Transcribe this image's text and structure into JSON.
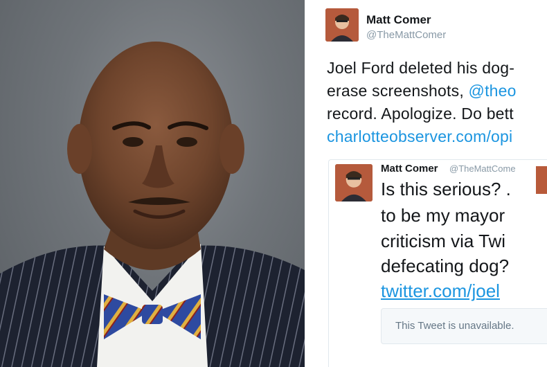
{
  "tweet": {
    "author_name": "Matt Comer",
    "author_handle": "@TheMattComer",
    "text_lines": [
      "Joel Ford deleted his dog-",
      "erase screenshots, ",
      "record. Apologize. Do bett",
      "charlotteobserver.com/opi"
    ],
    "mention_fragment": "@theo",
    "link_text": "charlotteobserver.com/opi"
  },
  "quoted": {
    "author_name": "Matt Comer",
    "author_handle": "@TheMattCome",
    "lines": [
      "Is this serious? .",
      "to be my mayor",
      "criticism via Twi",
      "defecating dog?",
      "twitter.com/joel"
    ],
    "unavailable_text": "This Tweet is unavailable."
  },
  "colors": {
    "link": "#1b95e0",
    "text": "#14171a",
    "muted": "#8899a6"
  }
}
